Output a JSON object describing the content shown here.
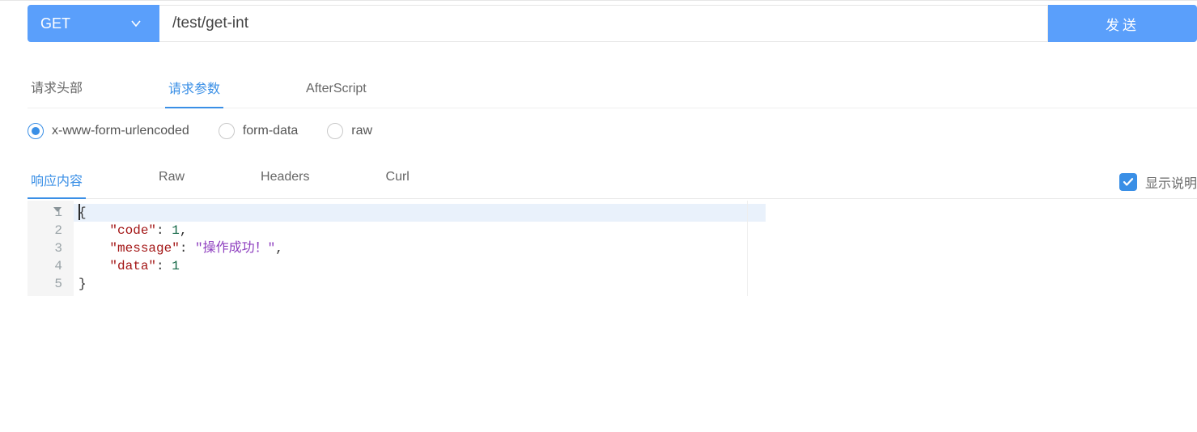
{
  "request": {
    "method": "GET",
    "url": "/test/get-int",
    "send_label": "发送"
  },
  "request_tabs": {
    "items": [
      "请求头部",
      "请求参数",
      "AfterScript"
    ],
    "active_index": 1
  },
  "body_types": {
    "items": [
      "x-www-form-urlencoded",
      "form-data",
      "raw"
    ],
    "selected_index": 0
  },
  "response_tabs": {
    "items": [
      "响应内容",
      "Raw",
      "Headers",
      "Curl"
    ],
    "active_index": 0
  },
  "show_desc": {
    "label": "显示说明",
    "checked": true
  },
  "code": {
    "lines": [
      {
        "n": 1,
        "foldable": true,
        "tokens": [
          [
            "brace",
            "{"
          ]
        ]
      },
      {
        "n": 2,
        "foldable": false,
        "tokens": [
          [
            "plain",
            "    "
          ],
          [
            "key",
            "\"code\""
          ],
          [
            "punc",
            ": "
          ],
          [
            "num",
            "1"
          ],
          [
            "punc",
            ","
          ]
        ]
      },
      {
        "n": 3,
        "foldable": false,
        "tokens": [
          [
            "plain",
            "    "
          ],
          [
            "key",
            "\"message\""
          ],
          [
            "punc",
            ": "
          ],
          [
            "str",
            "\"操作成功！\""
          ],
          [
            "punc",
            ","
          ]
        ]
      },
      {
        "n": 4,
        "foldable": false,
        "tokens": [
          [
            "plain",
            "    "
          ],
          [
            "key",
            "\"data\""
          ],
          [
            "punc",
            ": "
          ],
          [
            "num",
            "1"
          ]
        ]
      },
      {
        "n": 5,
        "foldable": false,
        "tokens": [
          [
            "brace",
            "}"
          ]
        ]
      }
    ],
    "active_line": 1
  }
}
